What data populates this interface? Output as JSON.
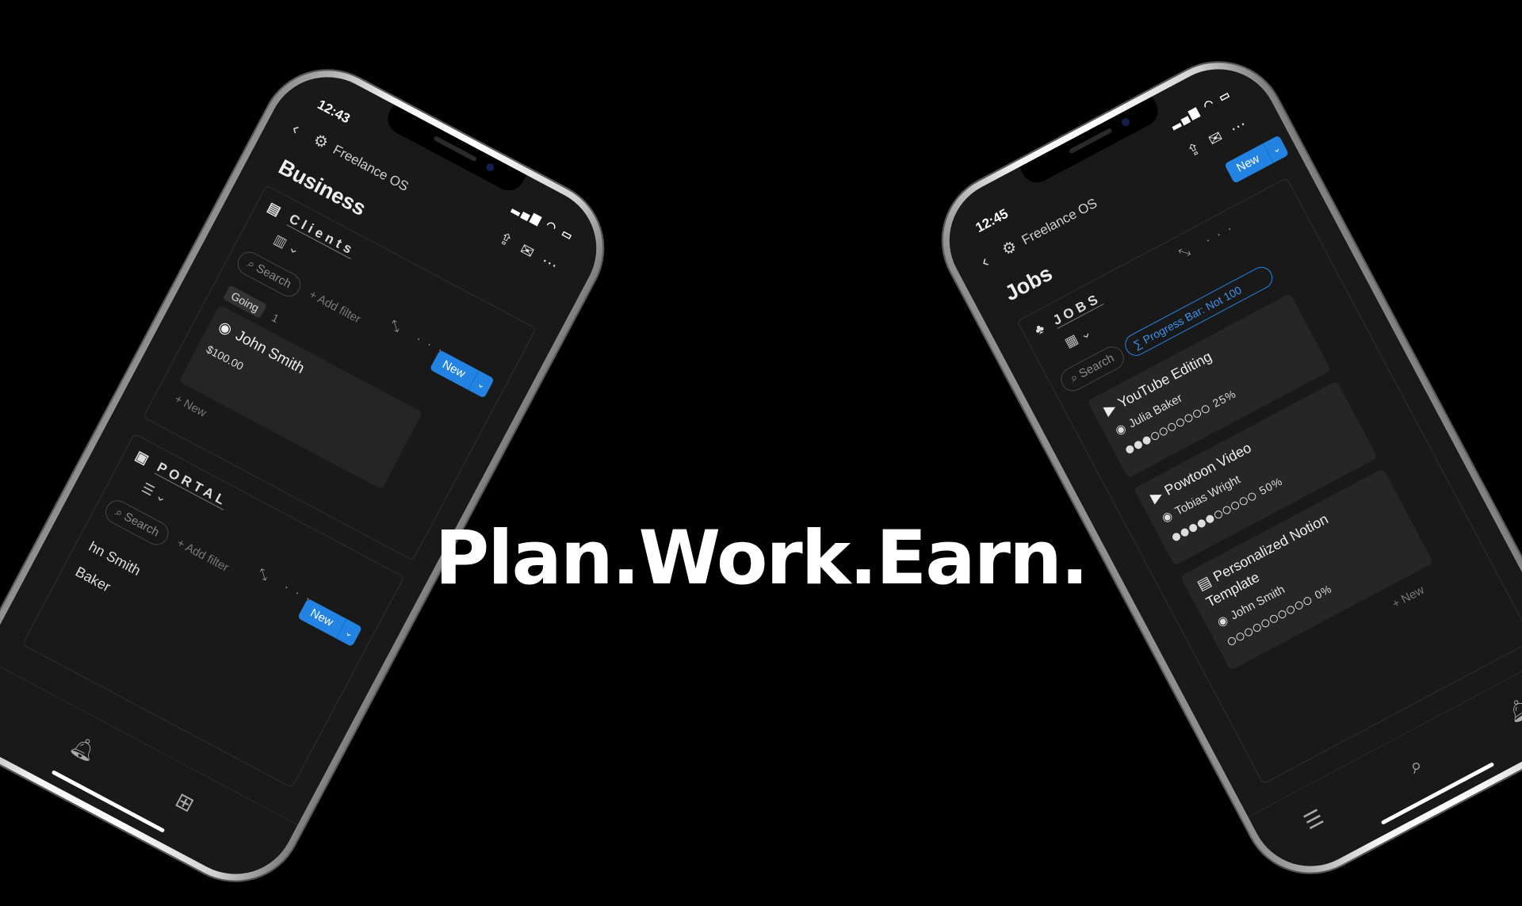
{
  "tagline": "Plan.Work.Earn.",
  "left_phone": {
    "time": "12:43",
    "status_icons": "▂▄▆ ◠ ▭",
    "back_icon": "‹",
    "breadcrumb": "Freelance OS",
    "page_title": "Business",
    "clients": {
      "title": "Clients",
      "view_icon": "▥ ⌄",
      "search": "Search",
      "add_filter": "+ Add filter",
      "tools": "⤡ ···",
      "new_label": "New",
      "group": "Going",
      "group_count": "1",
      "card_name": "John Smith",
      "card_price": "$100.00",
      "add_new": "+ New"
    },
    "portal": {
      "title": "PORTAL",
      "view_icon": "☰ ⌄",
      "search": "Search",
      "add_filter": "+ Add filter",
      "tools": "⤡ ···",
      "new_label": "New",
      "rows": [
        "hn Smith",
        "Baker"
      ]
    }
  },
  "right_phone": {
    "time": "12:45",
    "status_icons": "▂▄▆ ◠ ▭",
    "back_icon": "‹",
    "breadcrumb": "Freelance OS",
    "page_title": "Jobs",
    "new_label": "New",
    "jobs": {
      "title": "JOBS",
      "view_icon": "▦ ⌄",
      "tools": "⤡ ···",
      "search": "Search",
      "rollup": "∑ Progress Bar: Not 100",
      "add_new": "+ New",
      "cards": [
        {
          "title": "YouTube Editing",
          "person": "Julia Baker",
          "progress": 25,
          "progress_text": "25%"
        },
        {
          "title": "Powtoon Video",
          "person": "Tobias Wright",
          "progress": 50,
          "progress_text": "50%"
        },
        {
          "title": "Personalized Notion Template",
          "person": "John Smith",
          "progress": 0,
          "progress_text": "0%"
        }
      ]
    }
  }
}
